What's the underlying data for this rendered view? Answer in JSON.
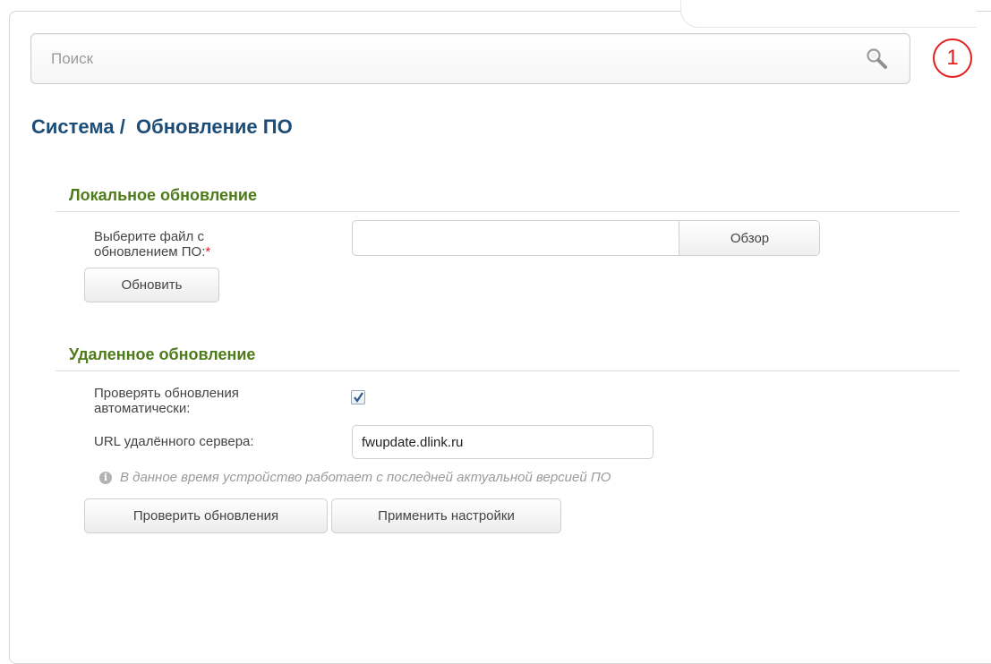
{
  "search": {
    "placeholder": "Поиск"
  },
  "notifications": {
    "count": "1"
  },
  "page": {
    "title": "Система /  Обновление ПО"
  },
  "local_update": {
    "heading": "Локальное обновление",
    "file_label": "Выберите файл с обновлением ПО:",
    "required_mark": "*",
    "file_value": "",
    "browse_label": "Обзор",
    "update_button": "Обновить"
  },
  "remote_update": {
    "heading": "Удаленное обновление",
    "auto_check_label": "Проверять обновления автоматически:",
    "auto_check_checked": true,
    "url_label": "URL удалённого сервера:",
    "url_value": "fwupdate.dlink.ru",
    "info_text": "В данное время устройство работает с последней актуальной версией ПО",
    "check_button": "Проверить обновления",
    "apply_button": "Применить настройки"
  },
  "colors": {
    "title": "#1c4d78",
    "section": "#4e7b1a",
    "notification": "#e0201f"
  }
}
